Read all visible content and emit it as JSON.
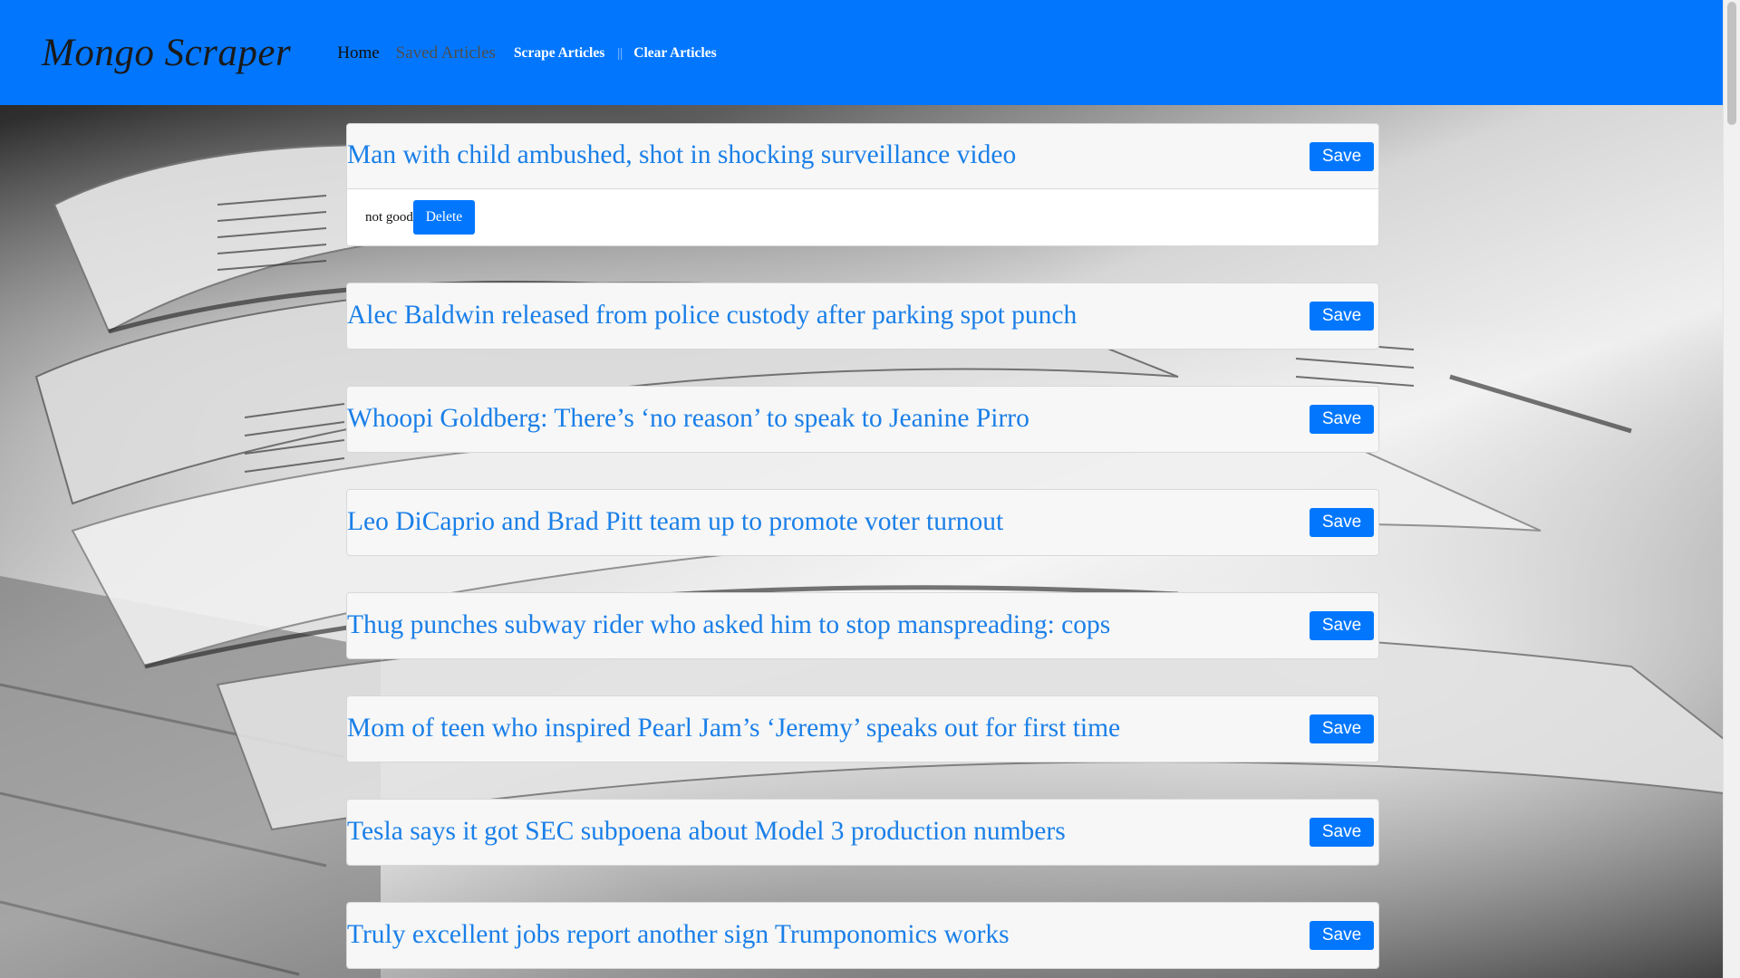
{
  "navbar": {
    "brand": "Mongo Scraper",
    "links": {
      "home": "Home",
      "saved": "Saved Articles",
      "scrape": "Scrape Articles",
      "separator": "||",
      "clear": "Clear Articles"
    },
    "background_color": "#0277fe"
  },
  "articles": [
    {
      "headline": "Man with child ambushed, shot in shocking surveillance video",
      "save_label": "Save",
      "note": {
        "text": "not good",
        "delete_label": "Delete"
      }
    },
    {
      "headline": "Alec Baldwin released from police custody after parking spot punch",
      "save_label": "Save"
    },
    {
      "headline": "Whoopi Goldberg: There’s ‘no reason’ to speak to Jeanine Pirro",
      "save_label": "Save"
    },
    {
      "headline": "Leo DiCaprio and Brad Pitt team up to promote voter turnout",
      "save_label": "Save"
    },
    {
      "headline": "Thug punches subway rider who asked him to stop manspreading: cops",
      "save_label": "Save"
    },
    {
      "headline": "Mom of teen who inspired Pearl Jam’s ‘Jeremy’ speaks out for first time",
      "save_label": "Save"
    },
    {
      "headline": "Tesla says it got SEC subpoena about Model 3 production numbers",
      "save_label": "Save"
    },
    {
      "headline": "Truly excellent jobs report another sign Trumponomics works",
      "save_label": "Save"
    }
  ],
  "colors": {
    "accent": "#0277fe",
    "headline": "#1a7fe8",
    "card_header": "#f7f7f7"
  }
}
